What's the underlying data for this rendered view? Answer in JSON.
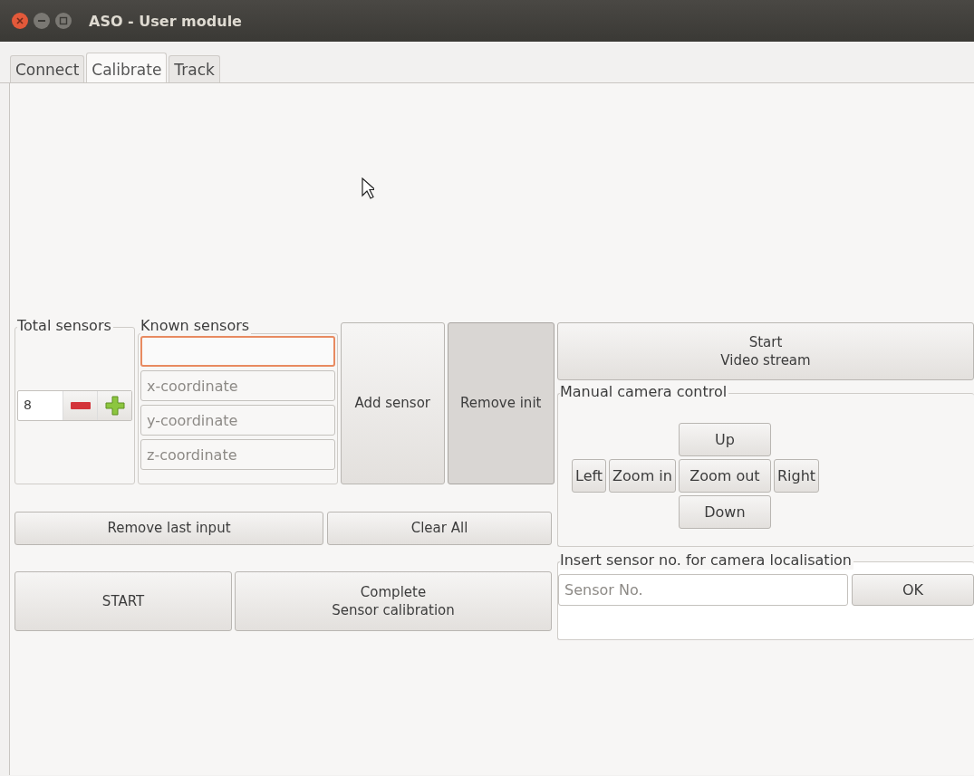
{
  "window": {
    "title": "ASO - User module"
  },
  "tabs": [
    {
      "label": "Connect",
      "selected": false
    },
    {
      "label": "Calibrate",
      "selected": true
    },
    {
      "label": "Track",
      "selected": false
    }
  ],
  "total_sensors": {
    "label": "Total sensors",
    "value": "8"
  },
  "known_sensors": {
    "label": "Known sensors",
    "fields": [
      {
        "focused": true
      },
      {
        "placeholder": "x-coordinate",
        "focused": false
      },
      {
        "placeholder": "y-coordinate",
        "focused": false
      },
      {
        "placeholder": "z-coordinate",
        "focused": false
      }
    ]
  },
  "sensor_buttons": [
    {
      "label": "Add sensor",
      "pressed": false
    },
    {
      "label": "Remove init",
      "pressed": true
    }
  ],
  "edit_buttons": [
    "Remove last input",
    "Clear All"
  ],
  "run_buttons": [
    "START",
    "Complete\nSensor calibration"
  ],
  "video_button": "Start\nVideo stream",
  "camera_control": {
    "label": "Manual camera control",
    "up": "Up",
    "left": "Left",
    "zoom_in": "Zoom in",
    "zoom_out": "Zoom out",
    "right": "Right",
    "down": "Down"
  },
  "localisation": {
    "label": "Insert sensor no. for camera localisation",
    "placeholder": "Sensor No.",
    "button": "OK"
  }
}
